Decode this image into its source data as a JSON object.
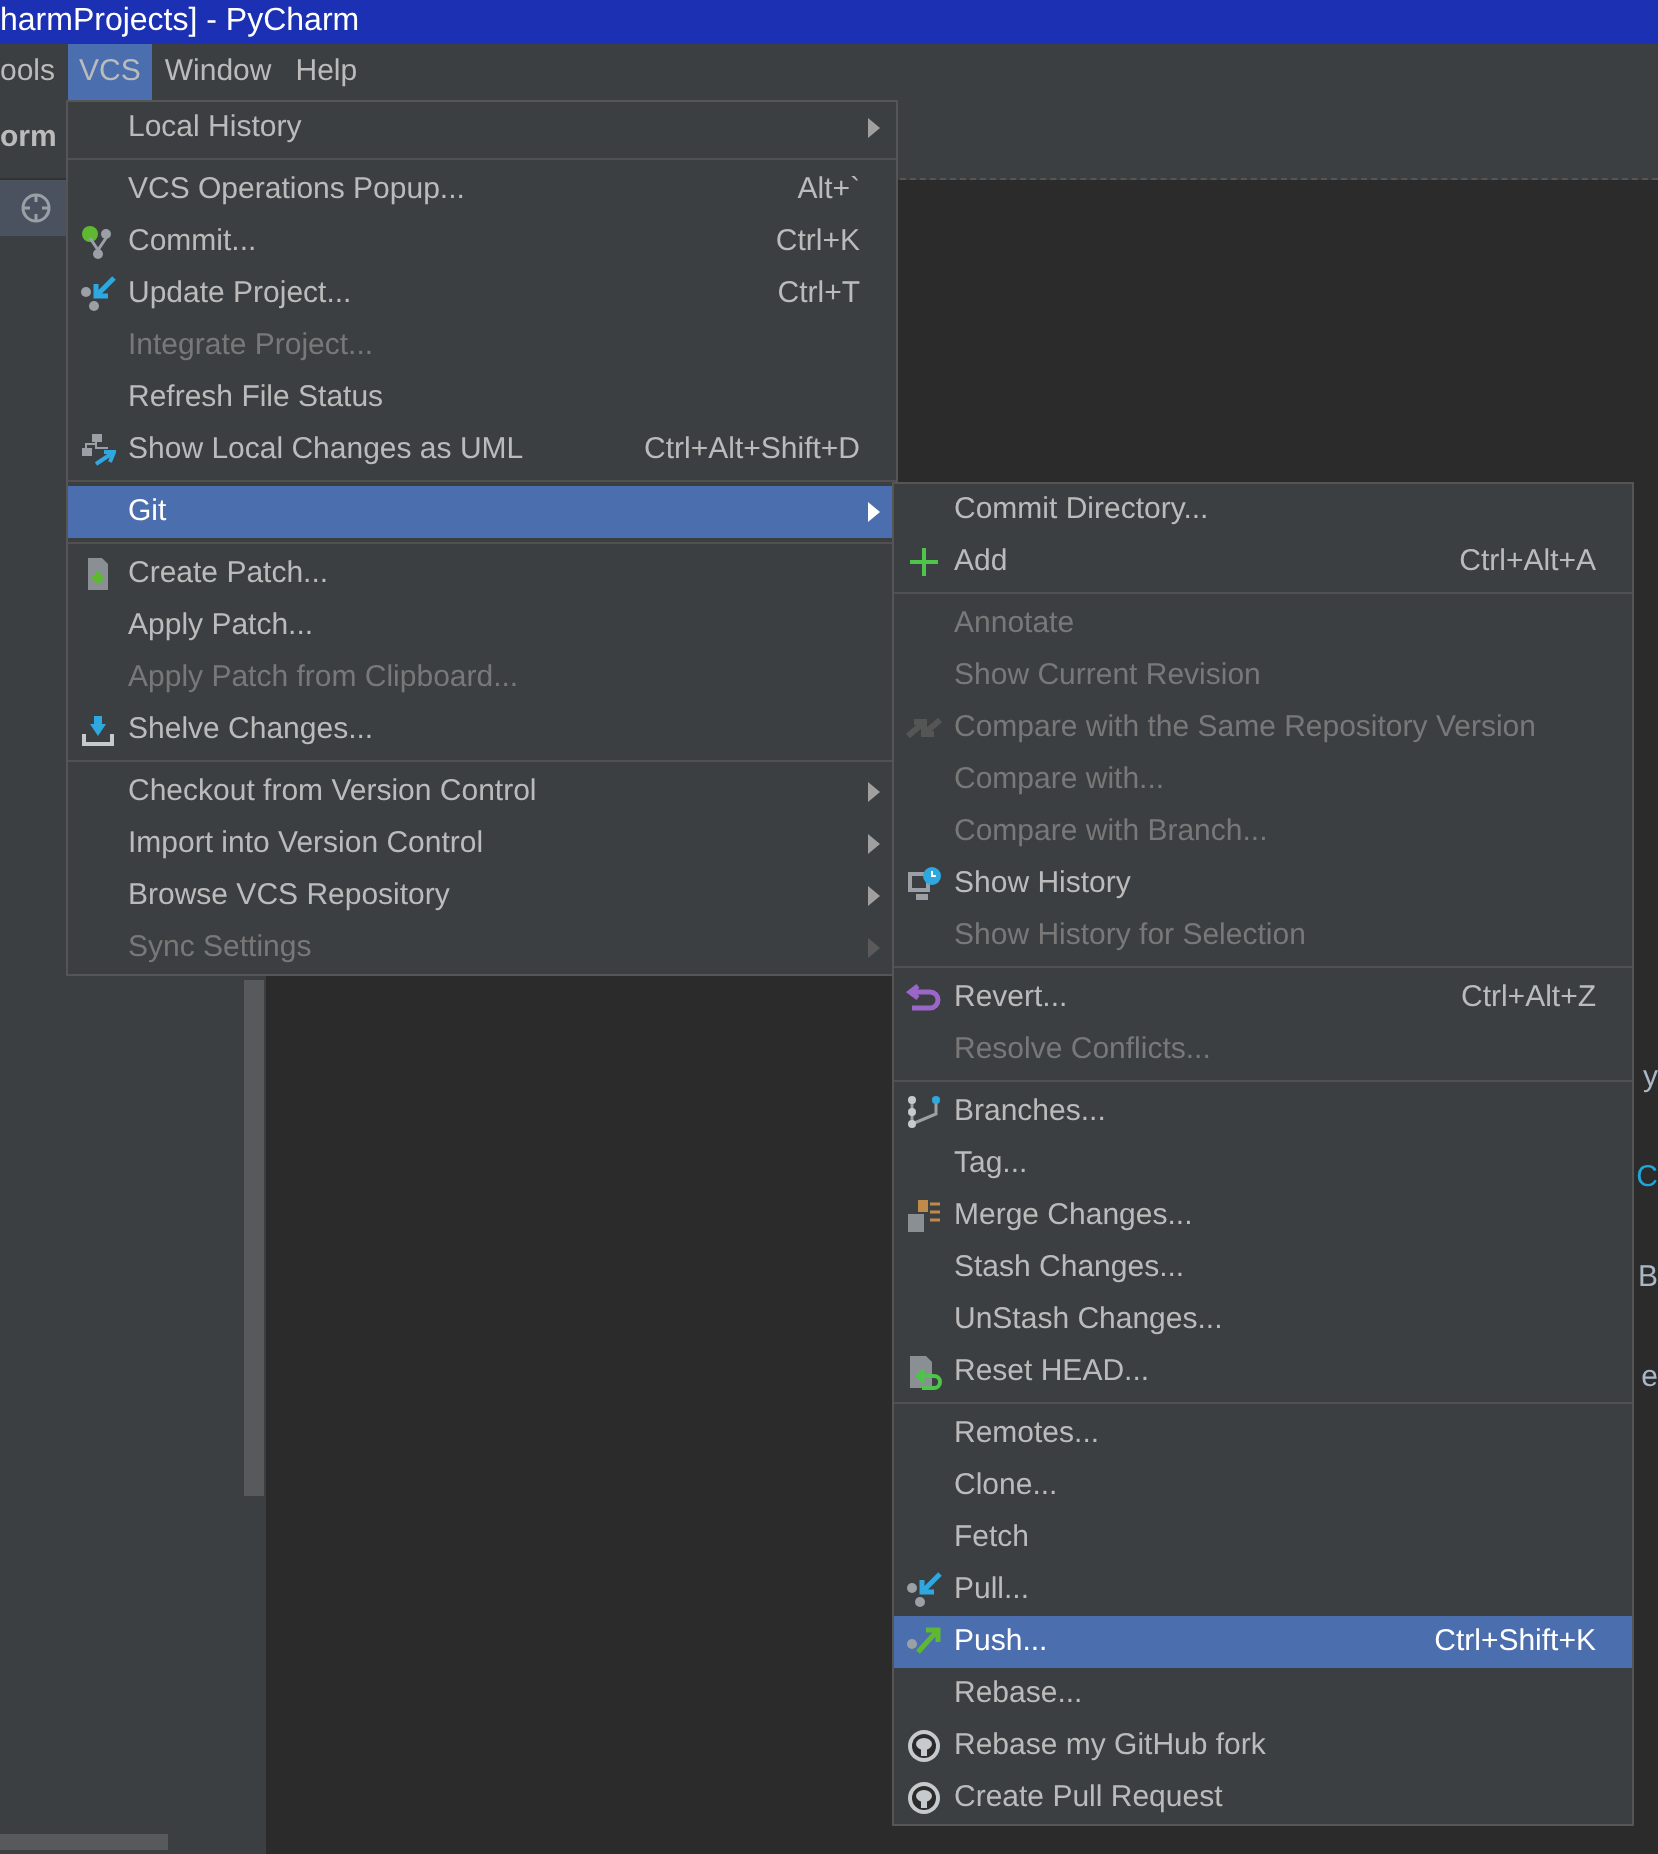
{
  "window": {
    "title": "harmProjects] - PyCharm"
  },
  "menu_bar": [
    {
      "label": "ools",
      "selected": false
    },
    {
      "label": "VCS",
      "selected": true
    },
    {
      "label": "Window",
      "selected": false
    },
    {
      "label": "Help",
      "selected": false
    }
  ],
  "left_panel": {
    "title": "orm"
  },
  "editor_fragments": [
    "y",
    "C",
    "B",
    "e"
  ],
  "vcs_menu": [
    {
      "kind": "item",
      "label": "Local History",
      "submenu": true,
      "disabled": false,
      "selected": false
    },
    {
      "kind": "separator"
    },
    {
      "kind": "item",
      "label": "VCS Operations Popup...",
      "shortcut": "Alt+`",
      "disabled": false,
      "selected": false
    },
    {
      "kind": "item",
      "label": "Commit...",
      "shortcut": "Ctrl+K",
      "disabled": false,
      "selected": false
    },
    {
      "kind": "item",
      "label": "Update Project...",
      "shortcut": "Ctrl+T",
      "disabled": false,
      "selected": false
    },
    {
      "kind": "item",
      "label": "Integrate Project...",
      "disabled": true,
      "selected": false
    },
    {
      "kind": "item",
      "label": "Refresh File Status",
      "disabled": false,
      "selected": false
    },
    {
      "kind": "item",
      "label": "Show Local Changes as UML",
      "shortcut": "Ctrl+Alt+Shift+D",
      "disabled": false,
      "selected": false
    },
    {
      "kind": "separator"
    },
    {
      "kind": "item",
      "label": "Git",
      "submenu": true,
      "disabled": false,
      "selected": true
    },
    {
      "kind": "separator"
    },
    {
      "kind": "item",
      "label": "Create Patch...",
      "disabled": false,
      "selected": false
    },
    {
      "kind": "item",
      "label": "Apply Patch...",
      "disabled": false,
      "selected": false
    },
    {
      "kind": "item",
      "label": "Apply Patch from Clipboard...",
      "disabled": true,
      "selected": false
    },
    {
      "kind": "item",
      "label": "Shelve Changes...",
      "disabled": false,
      "selected": false
    },
    {
      "kind": "separator"
    },
    {
      "kind": "item",
      "label": "Checkout from Version Control",
      "submenu": true,
      "disabled": false,
      "selected": false
    },
    {
      "kind": "item",
      "label": "Import into Version Control",
      "submenu": true,
      "disabled": false,
      "selected": false
    },
    {
      "kind": "item",
      "label": "Browse VCS Repository",
      "submenu": true,
      "disabled": false,
      "selected": false
    },
    {
      "kind": "item",
      "label": "Sync Settings",
      "submenu": true,
      "disabled": true,
      "selected": false
    }
  ],
  "git_menu": [
    {
      "kind": "item",
      "label": "Commit Directory...",
      "disabled": false,
      "selected": false
    },
    {
      "kind": "item",
      "label": "Add",
      "shortcut": "Ctrl+Alt+A",
      "disabled": false,
      "selected": false
    },
    {
      "kind": "separator"
    },
    {
      "kind": "item",
      "label": "Annotate",
      "disabled": true,
      "selected": false
    },
    {
      "kind": "item",
      "label": "Show Current Revision",
      "disabled": true,
      "selected": false
    },
    {
      "kind": "item",
      "label": "Compare with the Same Repository Version",
      "disabled": true,
      "selected": false
    },
    {
      "kind": "item",
      "label": "Compare with...",
      "disabled": true,
      "selected": false
    },
    {
      "kind": "item",
      "label": "Compare with Branch...",
      "disabled": true,
      "selected": false
    },
    {
      "kind": "item",
      "label": "Show History",
      "disabled": false,
      "selected": false
    },
    {
      "kind": "item",
      "label": "Show History for Selection",
      "disabled": true,
      "selected": false
    },
    {
      "kind": "separator"
    },
    {
      "kind": "item",
      "label": "Revert...",
      "shortcut": "Ctrl+Alt+Z",
      "disabled": false,
      "selected": false
    },
    {
      "kind": "item",
      "label": "Resolve Conflicts...",
      "disabled": true,
      "selected": false
    },
    {
      "kind": "separator"
    },
    {
      "kind": "item",
      "label": "Branches...",
      "disabled": false,
      "selected": false
    },
    {
      "kind": "item",
      "label": "Tag...",
      "disabled": false,
      "selected": false
    },
    {
      "kind": "item",
      "label": "Merge Changes...",
      "disabled": false,
      "selected": false
    },
    {
      "kind": "item",
      "label": "Stash Changes...",
      "disabled": false,
      "selected": false
    },
    {
      "kind": "item",
      "label": "UnStash Changes...",
      "disabled": false,
      "selected": false
    },
    {
      "kind": "item",
      "label": "Reset HEAD...",
      "disabled": false,
      "selected": false
    },
    {
      "kind": "separator"
    },
    {
      "kind": "item",
      "label": "Remotes...",
      "disabled": false,
      "selected": false
    },
    {
      "kind": "item",
      "label": "Clone...",
      "disabled": false,
      "selected": false
    },
    {
      "kind": "item",
      "label": "Fetch",
      "disabled": false,
      "selected": false
    },
    {
      "kind": "item",
      "label": "Pull...",
      "disabled": false,
      "selected": false
    },
    {
      "kind": "item",
      "label": "Push...",
      "shortcut": "Ctrl+Shift+K",
      "disabled": false,
      "selected": true
    },
    {
      "kind": "item",
      "label": "Rebase...",
      "disabled": false,
      "selected": false
    },
    {
      "kind": "item",
      "label": "Rebase my GitHub fork",
      "disabled": false,
      "selected": false
    },
    {
      "kind": "item",
      "label": "Create Pull Request",
      "disabled": false,
      "selected": false
    }
  ]
}
